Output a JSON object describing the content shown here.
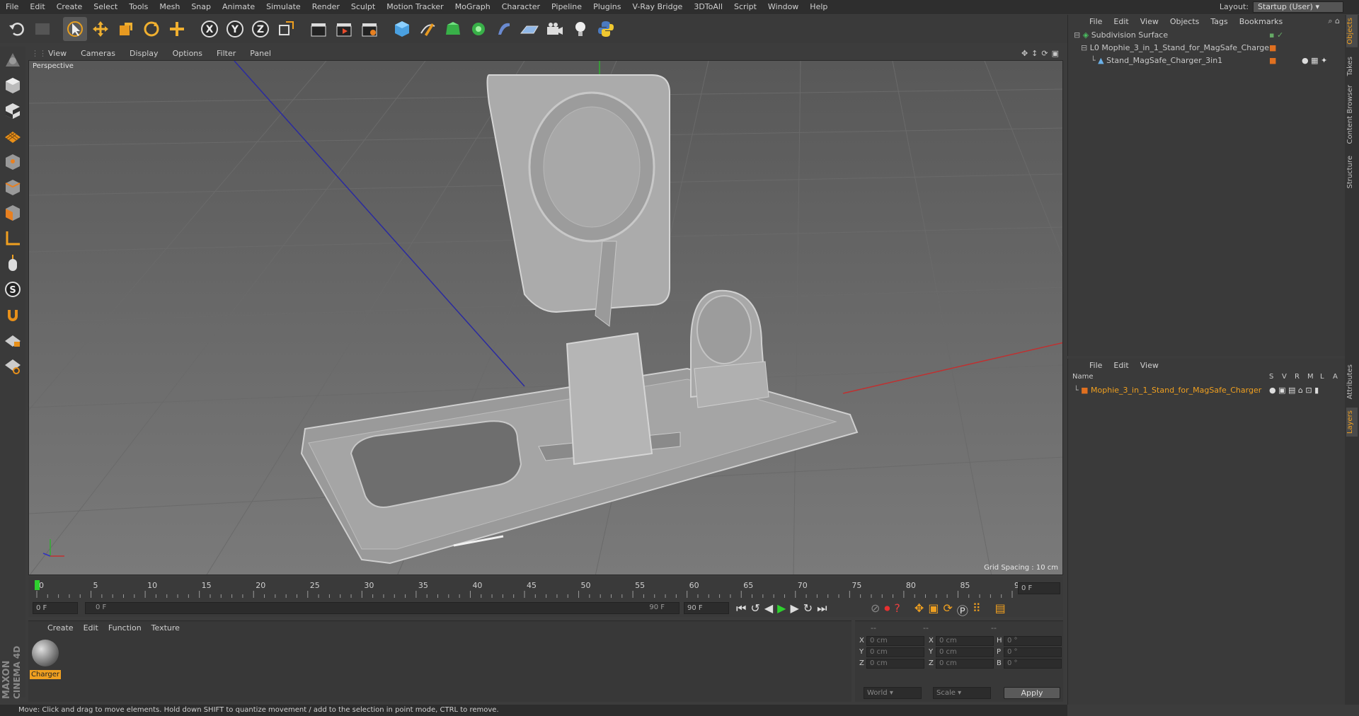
{
  "menubar": [
    "File",
    "Edit",
    "Create",
    "Select",
    "Tools",
    "Mesh",
    "Snap",
    "Animate",
    "Simulate",
    "Render",
    "Sculpt",
    "Motion Tracker",
    "MoGraph",
    "Character",
    "Pipeline",
    "Plugins",
    "V-Ray Bridge",
    "3DToAll",
    "Script",
    "Window",
    "Help"
  ],
  "layout": {
    "label": "Layout:",
    "value": "Startup (User)"
  },
  "viewport": {
    "menu": [
      "View",
      "Cameras",
      "Display",
      "Options",
      "Filter",
      "Panel"
    ],
    "label": "Perspective",
    "grid_spacing": "Grid Spacing : 10 cm"
  },
  "timeline": {
    "ticks": [
      "0",
      "5",
      "10",
      "15",
      "20",
      "25",
      "30",
      "35",
      "40",
      "45",
      "50",
      "55",
      "60",
      "65",
      "70",
      "75",
      "80",
      "85",
      "90"
    ],
    "current_frame": "0 F",
    "start_field": "0 F",
    "range_start": "0 F",
    "range_end": "90 F",
    "end_field": "90 F",
    "playhead_frame": 0,
    "max_frame": 90
  },
  "materials": {
    "menu": [
      "Create",
      "Edit",
      "Function",
      "Texture"
    ],
    "items": [
      "Charger"
    ]
  },
  "coordinates": {
    "headers": [
      "--",
      "--",
      "--"
    ],
    "rows": [
      {
        "a": "X",
        "av": "0 cm",
        "b": "X",
        "bv": "0 cm",
        "c": "H",
        "cv": "0 °"
      },
      {
        "a": "Y",
        "av": "0 cm",
        "b": "Y",
        "bv": "0 cm",
        "c": "P",
        "cv": "0 °"
      },
      {
        "a": "Z",
        "av": "0 cm",
        "b": "Z",
        "bv": "0 cm",
        "c": "B",
        "cv": "0 °"
      }
    ],
    "mode": "World",
    "size_mode": "Scale",
    "apply_label": "Apply"
  },
  "status": "Move: Click and drag to move elements. Hold down SHIFT to quantize movement / add to the selection in point mode, CTRL to remove.",
  "objects": {
    "menu": [
      "File",
      "Edit",
      "View",
      "Objects",
      "Tags",
      "Bookmarks"
    ],
    "tree": [
      {
        "name": "Subdivision Surface"
      },
      {
        "name": "Mophie_3_in_1_Stand_for_MagSafe_Charger"
      },
      {
        "name": "Stand_MagSafe_Charger_3in1"
      }
    ]
  },
  "layers": {
    "menu": [
      "File",
      "Edit",
      "View"
    ],
    "columns": [
      "Name",
      "S",
      "V",
      "R",
      "M",
      "L",
      "A"
    ],
    "items": [
      "Mophie_3_in_1_Stand_for_MagSafe_Charger"
    ]
  },
  "sidetabs": [
    "Objects",
    "Takes",
    "Content Browser",
    "Structure",
    "Attributes",
    "Layers"
  ],
  "colors": {
    "accent": "#f0a020",
    "playhead": "#2ed02e",
    "layer": "#e07020"
  }
}
